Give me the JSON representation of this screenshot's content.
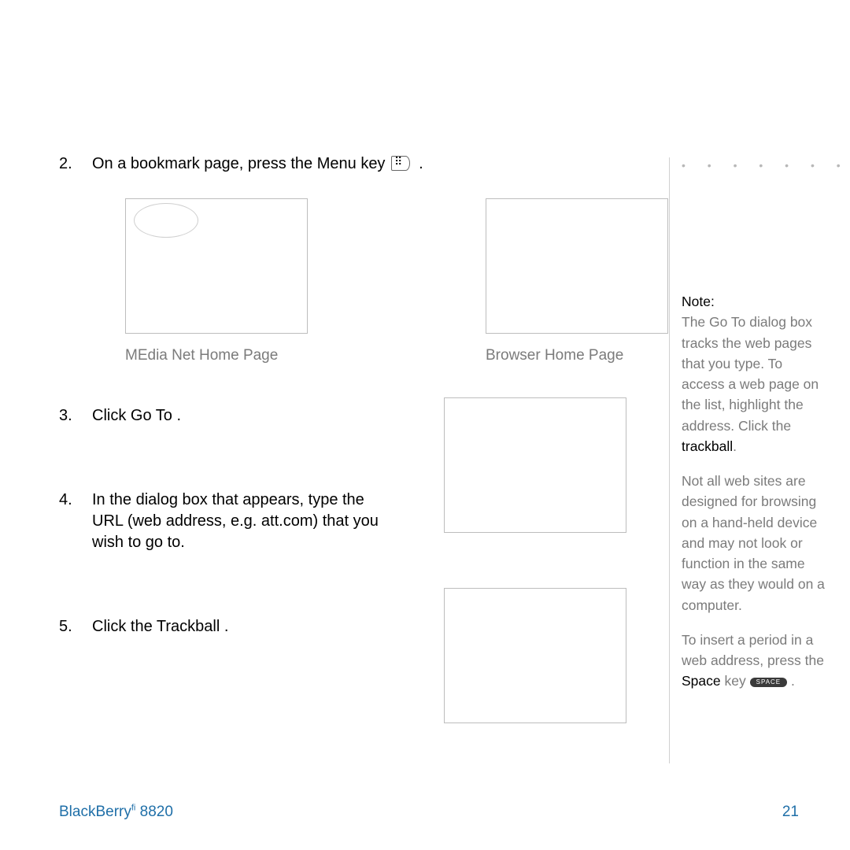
{
  "steps": {
    "s2_pre": "On a bookmark page, press the",
    "s2_menu_text": "Menu",
    "s2_post": "key",
    "s3_pre": "Click",
    "s3_em": "Go To",
    "s3_post": ".",
    "s4": "In the dialog box that appears, type the URL (web address, e.g. att.com) that you wish to go to.",
    "s5_pre": "Click the",
    "s5_em": "Trackball",
    "s5_post": "."
  },
  "figures": {
    "left_caption": "MEdia Net Home Page",
    "right_caption": "Browser Home Page"
  },
  "sidebar": {
    "note_label": "Note:",
    "p1a": "The Go To dialog box tracks the web pages that you type. To access a web page on the list, highlight the address. Click the",
    "p1_strong": "trackball",
    "p1b": ".",
    "p2": "Not all web sites are designed for browsing on a hand-held device and may not look or function in the same way as they would on a computer.",
    "p3a": "To insert a period in a web address, press the",
    "p3_strong": "Space",
    "p3b": "key",
    "p3_keycap": "SPACE",
    "p3c": "."
  },
  "footer": {
    "brand": "BlackBerry",
    "reg": "fi",
    "model": "8820",
    "page_number": "21"
  }
}
